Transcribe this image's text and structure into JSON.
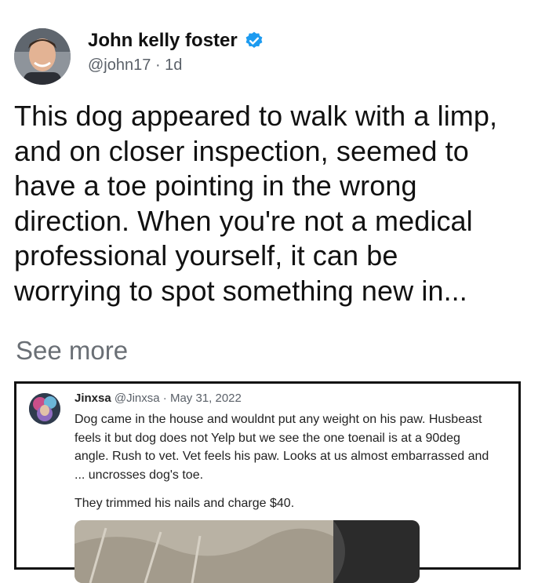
{
  "author": {
    "name": "John kelly foster",
    "handle": "@john17",
    "separator": "·",
    "age": "1d",
    "verified_icon": "verified-badge-icon",
    "badge_color": "#1d9bf0"
  },
  "tweet": {
    "lines": [
      "This dog appeared to walk with a limp,",
      "and on closer inspection, seemed to",
      "have a toe pointing in the wrong",
      "direction. When you're not a medical",
      "professional yourself, it can be",
      "worrying to spot something new in..."
    ],
    "see_more": "See more"
  },
  "quote": {
    "name": "Jinxsa",
    "handle": "@Jinxsa",
    "separator": "·",
    "date": "May 31, 2022",
    "lines": [
      "Dog came in the house and wouldnt put any weight on his paw. Husbeast",
      "feels it but dog does not Yelp but we see the one toenail is at a 90deg",
      "angle. Rush to vet. Vet feels his paw. Looks at us almost embarrassed and",
      "... uncrosses dog's toe."
    ],
    "line2": "They trimmed his nails and charge $40."
  }
}
